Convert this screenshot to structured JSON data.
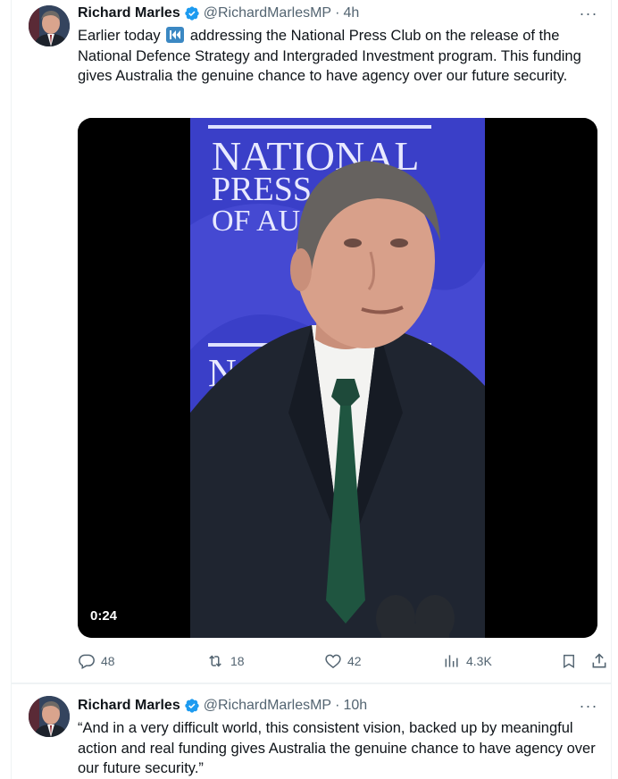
{
  "tweets": [
    {
      "author_name": "Richard Marles",
      "handle": "@RichardMarlesMP",
      "separator": "·",
      "time": "4h",
      "more_label": "···",
      "text_before_icon": "Earlier today",
      "text_after_icon": " addressing the National Press Club on the release of the National Defence Strategy and Intergraded Investment program. This funding gives Australia the genuine chance to have agency over our future security.",
      "inline_icon": "rewind-icon",
      "media": {
        "backdrop_lines": [
          "NATIONAL",
          "PRESS",
          "OF AU"
        ],
        "backdrop_lower": "NA",
        "duration": "0:24"
      },
      "actions": {
        "replies": "48",
        "reposts": "18",
        "likes": "42",
        "views": "4.3K"
      }
    },
    {
      "author_name": "Richard Marles",
      "handle": "@RichardMarlesMP",
      "separator": "·",
      "time": "10h",
      "more_label": "···",
      "text": "“And in a very difficult world, this consistent vision, backed up by meaningful action and real funding gives Australia the genuine chance to have agency over our future security.”"
    }
  ],
  "colors": {
    "text_primary": "#0f1419",
    "text_secondary": "#536471",
    "verified_blue": "#1d9bf0",
    "separator": "#eff3f4",
    "backdrop_blue": "#3a3fc8"
  }
}
